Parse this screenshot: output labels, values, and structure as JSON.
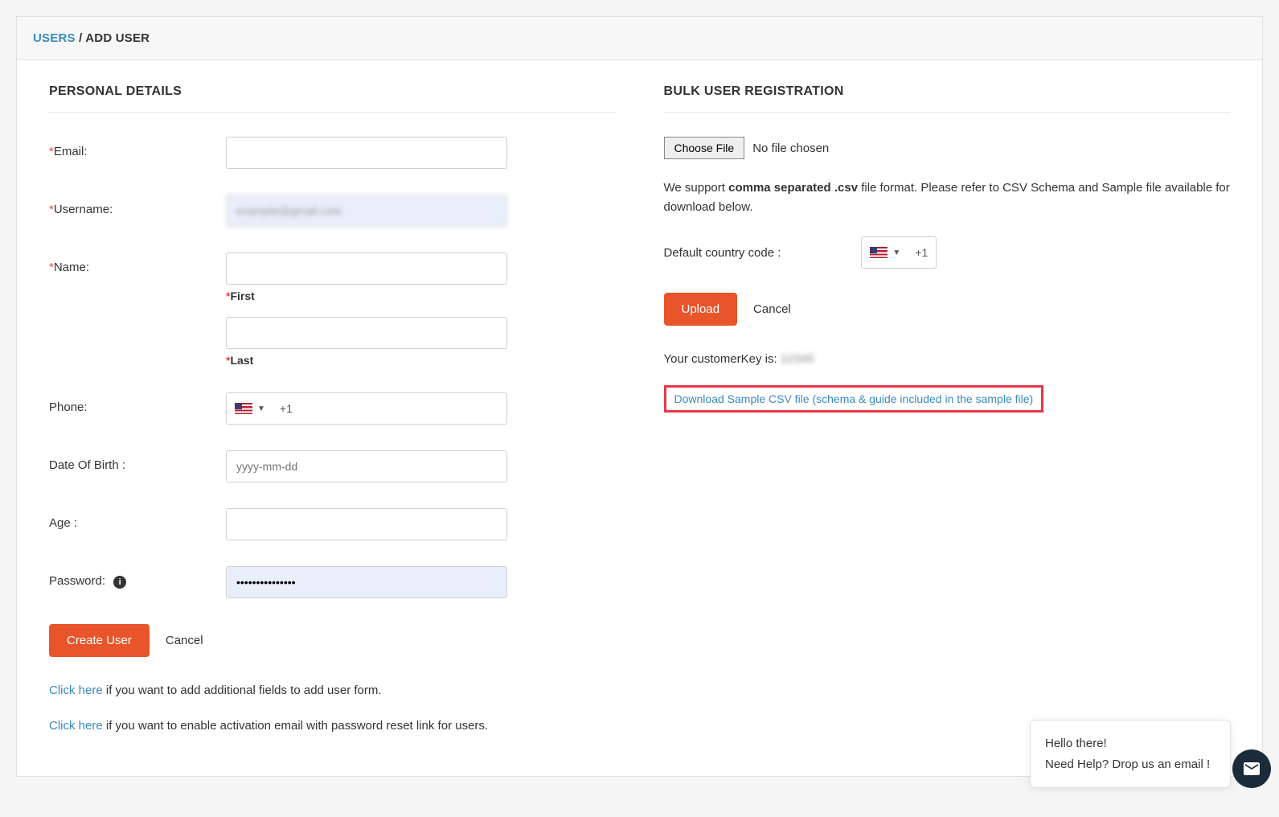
{
  "breadcrumb": {
    "users": "USERS",
    "sep": "/",
    "current": "ADD USER"
  },
  "left": {
    "title": "PERSONAL DETAILS",
    "email_label": "Email:",
    "username_label": "Username:",
    "username_value": "example@gmail.com",
    "name_label": "Name:",
    "first_sub": "First",
    "last_sub": "Last",
    "phone_label": "Phone:",
    "phone_code": "+1",
    "dob_label": "Date Of Birth :",
    "dob_placeholder": "yyyy-mm-dd",
    "age_label": "Age :",
    "password_label": "Password:",
    "password_value": "•••••••••••••••",
    "create_btn": "Create User",
    "cancel_btn": "Cancel",
    "note1_link": "Click here",
    "note1_text": " if you want to add additional fields to add user form.",
    "note2_link": "Click here",
    "note2_text": " if you want to enable activation email with password reset link for users."
  },
  "right": {
    "title": "BULK USER REGISTRATION",
    "choose_file": "Choose File",
    "no_file": "No file chosen",
    "support_pre": "We support ",
    "support_bold": "comma separated .csv",
    "support_post": " file format. Please refer to CSV Schema and Sample file available for download below.",
    "cc_label": "Default country code :",
    "cc_code": "+1",
    "upload_btn": "Upload",
    "cancel_btn": "Cancel",
    "ck_label": "Your customerKey is: ",
    "ck_value": "12345",
    "dl_link": "Download Sample CSV file (schema & guide included in the sample file)"
  },
  "chat": {
    "line1": "Hello there!",
    "line2": "Need Help? Drop us an email !"
  }
}
